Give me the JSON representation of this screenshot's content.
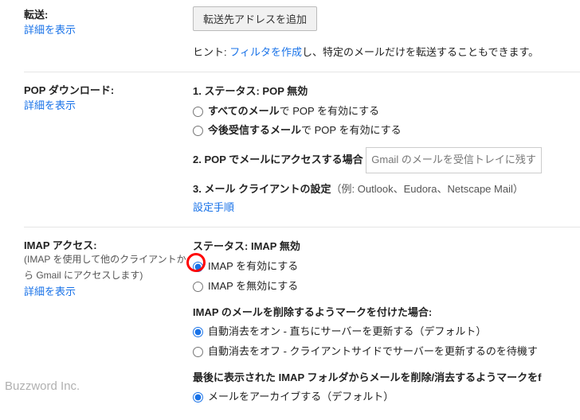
{
  "forwarding": {
    "title": "転送:",
    "detail_link": "詳細を表示",
    "add_button": "転送先アドレスを追加",
    "hint_prefix": "ヒント: ",
    "hint_link": "フィルタを作成",
    "hint_suffix": "し、特定のメールだけを転送することもできます。"
  },
  "pop": {
    "title": "POP ダウンロード:",
    "detail_link": "詳細を表示",
    "status_label": "1. ステータス: ",
    "status_value": "POP 無効",
    "opt_all_prefix": "すべてのメール",
    "opt_all_suffix": "で POP を有効にする",
    "opt_future_prefix": "今後受信するメール",
    "opt_future_suffix": "で POP を有効にする",
    "step2": "2. POP でメールにアクセスする場合",
    "step2_select": "Gmail のメールを受信トレイに残す",
    "step3": "3. メール クライアントの設定",
    "step3_example": "（例: Outlook、Eudora、Netscape Mail）",
    "step3_link": "設定手順"
  },
  "imap": {
    "title": "IMAP アクセス:",
    "subtitle1": "(IMAP を使用して他のクライアントか",
    "subtitle2": "ら Gmail にアクセスします)",
    "detail_link": "詳細を表示",
    "status_label": "ステータス: ",
    "status_value": "IMAP 無効",
    "opt_enable": "IMAP を有効にする",
    "opt_disable": "IMAP を無効にする",
    "delete_title": "IMAP のメールを削除するようマークを付けた場合:",
    "delete_opt_on": "自動消去をオン - 直ちにサーバーを更新する（デフォルト）",
    "delete_opt_off": "自動消去をオフ - クライアントサイドでサーバーを更新するのを待機す",
    "last_title": "最後に表示された IMAP フォルダからメールを削除/消去するようマークをf",
    "last_opt_archive": "メールをアーカイブする（デフォルト）"
  },
  "watermark": "Buzzword Inc."
}
